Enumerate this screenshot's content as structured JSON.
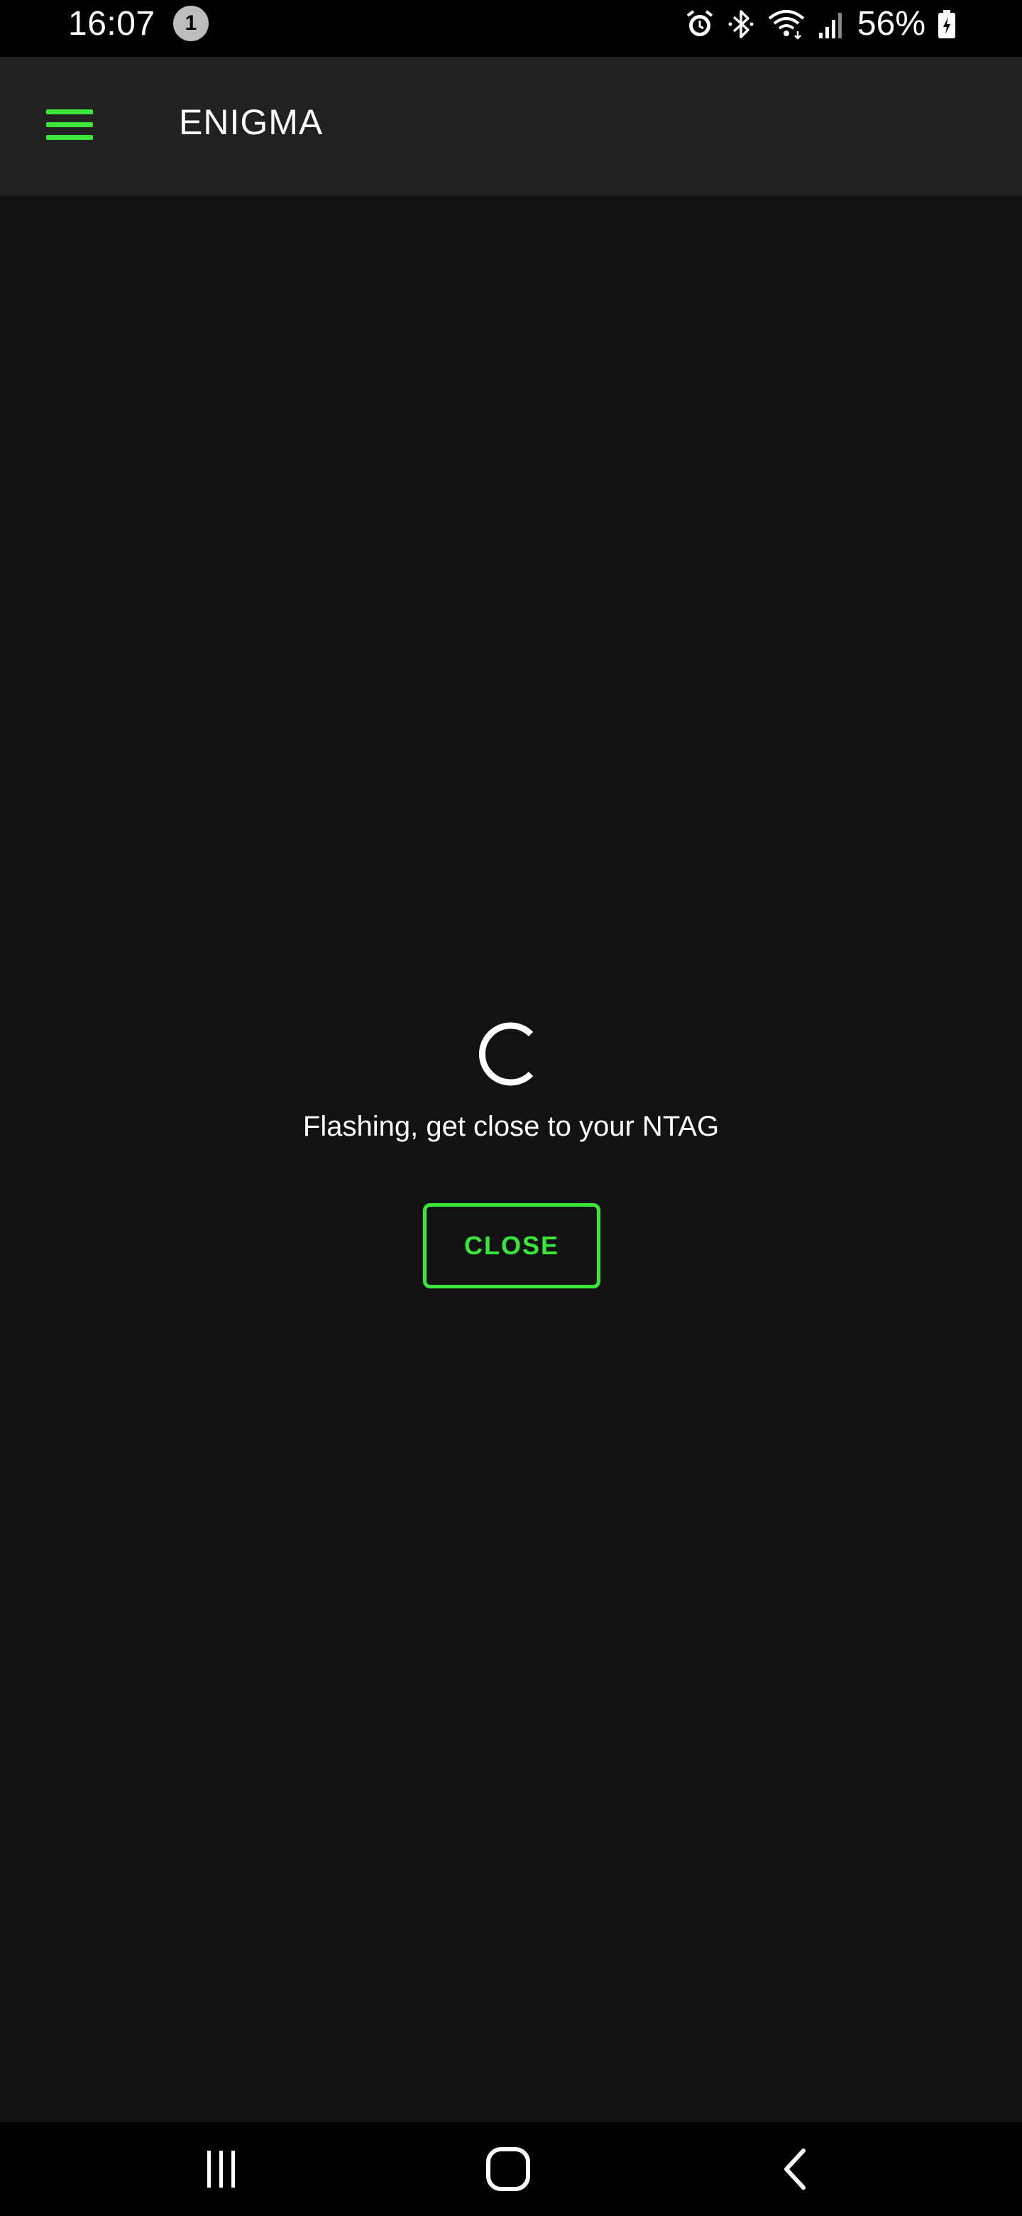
{
  "status_bar": {
    "time": "16:07",
    "notification_count": "1",
    "battery_percent": "56%",
    "icons": [
      "alarm-icon",
      "bluetooth-icon",
      "wifi-icon",
      "signal-icon",
      "battery-charging-icon"
    ]
  },
  "app_bar": {
    "title": "ENIGMA",
    "menu_icon": "hamburger-menu-icon"
  },
  "main": {
    "message": "Flashing, get close to your NTAG",
    "close_label": "CLOSE",
    "spinner_icon": "loading-spinner-icon"
  },
  "nav_bar": {
    "icons": [
      "recent-apps-icon",
      "home-icon",
      "back-icon"
    ]
  },
  "colors": {
    "accent": "#39e639",
    "background": "#121212",
    "app_bar": "#212121",
    "system_bars": "#000000"
  }
}
